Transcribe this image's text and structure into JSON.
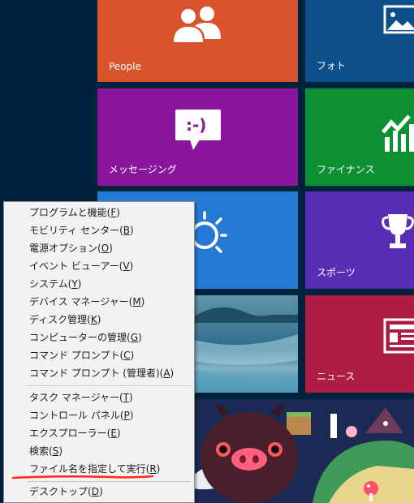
{
  "tiles": {
    "people": {
      "label": "People",
      "color": "#d8532b"
    },
    "photos": {
      "label": "フォト",
      "color": "#0d4f8b"
    },
    "messaging": {
      "label": "メッセージング",
      "color": "#8b169e"
    },
    "finance": {
      "label": "ファイナンス",
      "color": "#0d8f34"
    },
    "weather": {
      "label": "",
      "color": "#2479d6"
    },
    "sports": {
      "label": "スポーツ",
      "color": "#5a2db5"
    },
    "desktop": {
      "label": "",
      "color": "#2a6b8c"
    },
    "news": {
      "label": "ニュース",
      "color": "#ad1d43"
    }
  },
  "menu": {
    "group1": [
      {
        "text": "プログラムと機能(",
        "key": "F",
        "end": ")"
      },
      {
        "text": "モビリティ センター(",
        "key": "B",
        "end": ")"
      },
      {
        "text": "電源オプション(",
        "key": "O",
        "end": ")"
      },
      {
        "text": "イベント ビューアー(",
        "key": "V",
        "end": ")"
      },
      {
        "text": "システム(",
        "key": "Y",
        "end": ")"
      },
      {
        "text": "デバイス マネージャー(",
        "key": "M",
        "end": ")"
      },
      {
        "text": "ディスク管理(",
        "key": "K",
        "end": ")"
      },
      {
        "text": "コンピューターの管理(",
        "key": "G",
        "end": ")"
      },
      {
        "text": "コマンド プロンプト(",
        "key": "C",
        "end": ")"
      },
      {
        "text": "コマンド プロンプト (管理者)(",
        "key": "A",
        "end": ")"
      }
    ],
    "group2": [
      {
        "text": "タスク マネージャー(",
        "key": "T",
        "end": ")"
      },
      {
        "text": "コントロール パネル(",
        "key": "P",
        "end": ")"
      },
      {
        "text": "エクスプローラー(",
        "key": "E",
        "end": ")"
      },
      {
        "text": "検索(",
        "key": "S",
        "end": ")"
      },
      {
        "text": "ファイル名を指定して実行(",
        "key": "R",
        "end": ")"
      }
    ],
    "group3": [
      {
        "text": "デスクトップ(",
        "key": "D",
        "end": ")"
      }
    ]
  },
  "annotation": {
    "color": "#ff2a1a"
  },
  "icons": {
    "people": "people-icon",
    "photos": "photo-icon",
    "messaging": "message-bubble-icon",
    "finance": "chart-icon",
    "weather": "sun-icon",
    "sports": "trophy-icon",
    "news": "newspaper-icon"
  }
}
